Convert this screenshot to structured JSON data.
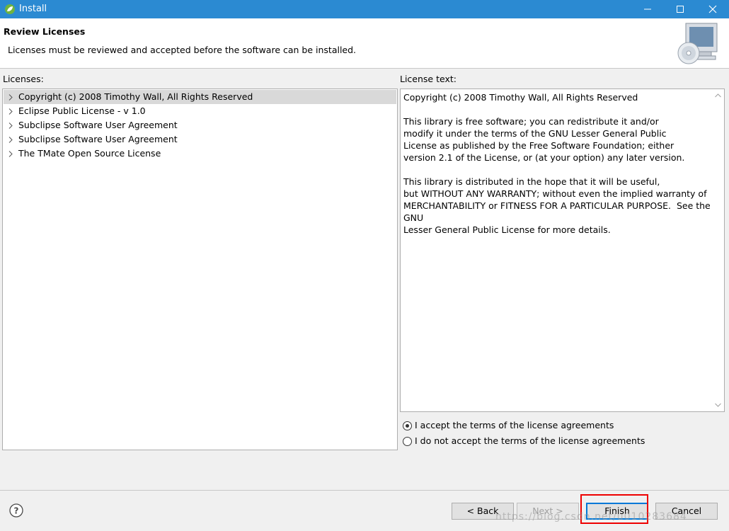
{
  "window": {
    "title": "Install",
    "icon": "leaf-icon"
  },
  "header": {
    "title": "Review Licenses",
    "description": "Licenses must be reviewed and accepted before the software can be installed."
  },
  "licenses_panel": {
    "label": "Licenses:",
    "items": [
      {
        "label": "Copyright (c) 2008 Timothy Wall, All Rights Reserved",
        "selected": true
      },
      {
        "label": "Eclipse Public License - v 1.0"
      },
      {
        "label": "Subclipse Software User Agreement"
      },
      {
        "label": "Subclipse Software User Agreement"
      },
      {
        "label": "The TMate Open Source License"
      }
    ]
  },
  "license_text_panel": {
    "label": "License text:",
    "text": "Copyright (c) 2008 Timothy Wall, All Rights Reserved\n\nThis library is free software; you can redistribute it and/or\nmodify it under the terms of the GNU Lesser General Public\nLicense as published by the Free Software Foundation; either\nversion 2.1 of the License, or (at your option) any later version.\n\nThis library is distributed in the hope that it will be useful,\nbut WITHOUT ANY WARRANTY; without even the implied warranty of\nMERCHANTABILITY or FITNESS FOR A PARTICULAR PURPOSE.  See the\nGNU\nLesser General Public License for more details."
  },
  "options": {
    "accept": "I accept the terms of the license agreements",
    "decline": "I do not accept the terms of the license agreements",
    "selected": "accept"
  },
  "buttons": {
    "back": "< Back",
    "next": "Next >",
    "finish": "Finish",
    "cancel": "Cancel"
  },
  "watermark": "https://blog.csdn.net/u010283684",
  "colors": {
    "titlebar": "#2b8ad2",
    "highlight": "#ee0000"
  }
}
